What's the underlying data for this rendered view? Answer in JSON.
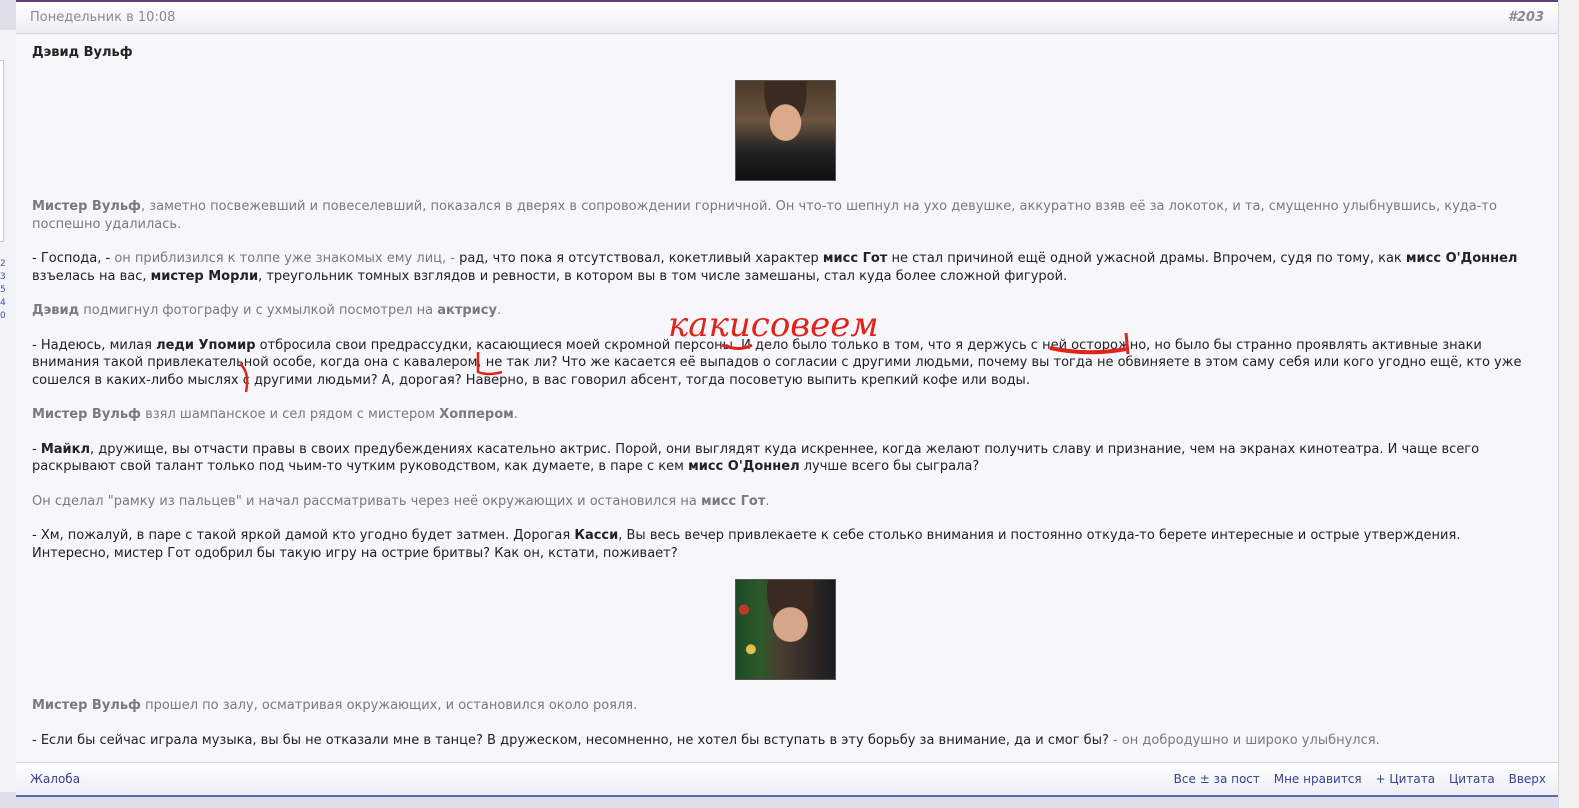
{
  "post": {
    "date": "Понедельник в 10:08",
    "number": "#203",
    "author": "Дэвид Вульф"
  },
  "left_strip": {
    "digits": [
      "2",
      "3",
      "5",
      "4",
      "0"
    ]
  },
  "content": {
    "p1": {
      "name": "Мистер Вульф",
      "text": ", заметно посвежевший и повеселевший, показался в дверях в сопровождении горничной. Он что-то шепнул на ухо девушке, аккуратно взяв её за локоток, и та, смущенно улыбнувшись, куда-то поспешно удалилась."
    },
    "p2": {
      "a": "- Господа, -",
      "b": " он приблизился к толпе уже знакомых ему лиц, -",
      "c": " рад, что пока я отсутствовал, кокетливый характер ",
      "d": "мисс Гот",
      "e": " не стал причиной ещё одной ужасной драмы. Впрочем, судя по тому, как ",
      "f": "мисс О'Доннел",
      "g": " взъелась на вас, ",
      "h": "мистер Морли",
      "i": ", треугольник томных взглядов и ревности, в котором вы в том числе замешаны, стал куда более сложной фигурой."
    },
    "p3": {
      "a": "Дэвид",
      "b": " подмигнул фотографу и с ухмылкой посмотрел на ",
      "c": "актрису",
      "d": "."
    },
    "p4": {
      "a": "- Надеюсь, милая ",
      "b": "леди Упомир",
      "c": " отбросила свои предрассудки, касающиеся моей скромной персоны. И дело было только в том, что я держусь с ней осторожно, но было бы странно проявлять активные знаки внимания такой привлекательной особе, когда она с кавалером, не так ли? Что же касается её выпадов о согласии с другими людьми, почему вы тогда не обвиняете в этом саму себя или кого угодно ещё, кто уже сошелся в каких-либо мыслях с другими людьми? А, дорогая? Наверно, в вас говорил абсент, тогда посоветую выпить крепкий кофе или воды."
    },
    "p5": {
      "a": "Мистер Вульф",
      "b": " взял шампанское и сел рядом с мистером ",
      "c": "Хоппером",
      "d": "."
    },
    "p6": {
      "a": "- ",
      "b": "Майкл",
      "c": ", дружище, вы отчасти правы в своих предубеждениях касательно актрис. Порой, они выглядят куда искреннее, когда желают получить славу и признание, чем на экранах кинотеатра. И чаще всего раскрывают свой талант только под чьим-то чутким руководством, как думаете, в паре с кем ",
      "d": "мисс О'Доннел",
      "e": " лучше всего бы сыграла?"
    },
    "p7": {
      "a": "Он сделал \"рамку из пальцев\" и начал рассматривать через неё окружающих и остановился на ",
      "b": "мисс Гот",
      "c": "."
    },
    "p8": {
      "a": "- Хм, пожалуй, в паре с такой яркой дамой кто угодно будет затмен. Дорогая ",
      "b": "Касси",
      "c": ", Вы весь вечер привлекаете к себе столько внимания и постоянно откуда-то берете интересные и острые утверждения. Интересно, мистер Гот одобрил бы такую игру на острие бритвы? Как он, кстати, поживает?"
    },
    "p9": {
      "a": "Мистер Вульф",
      "b": " прошел по залу, осматривая окружающих, и остановился около рояля."
    },
    "p10": {
      "a": "- Если бы сейчас играла музыка, вы бы не отказали мне в танце? В дружеском, несомненно, не хотел бы вступать в эту борьбу за внимание, да и смог бы?",
      "b": " - он добродушно и широко улыбнулся."
    }
  },
  "annotation": {
    "handwritten_text": "какисовеем",
    "color": "#e2231a"
  },
  "footer": {
    "report": "Жалоба",
    "actions": [
      "Все ± за пост",
      "Мне нравится",
      "+ Цитата",
      "Цитата",
      "Вверх"
    ]
  },
  "colors": {
    "header_accent": "#6c3a77",
    "footer_accent": "#5a6ab0",
    "link": "#3b3f8f"
  }
}
